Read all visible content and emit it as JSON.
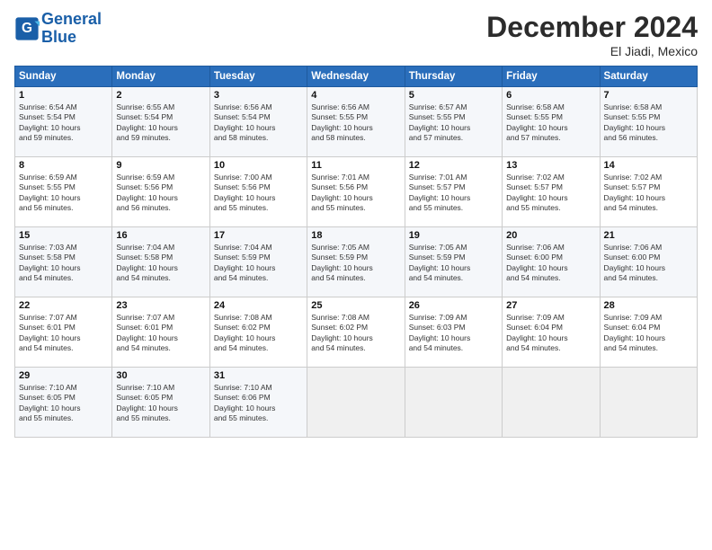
{
  "logo": {
    "line1": "General",
    "line2": "Blue"
  },
  "title": "December 2024",
  "location": "El Jiadi, Mexico",
  "days_of_week": [
    "Sunday",
    "Monday",
    "Tuesday",
    "Wednesday",
    "Thursday",
    "Friday",
    "Saturday"
  ],
  "weeks": [
    [
      {
        "day": "1",
        "info": "Sunrise: 6:54 AM\nSunset: 5:54 PM\nDaylight: 10 hours\nand 59 minutes."
      },
      {
        "day": "2",
        "info": "Sunrise: 6:55 AM\nSunset: 5:54 PM\nDaylight: 10 hours\nand 59 minutes."
      },
      {
        "day": "3",
        "info": "Sunrise: 6:56 AM\nSunset: 5:54 PM\nDaylight: 10 hours\nand 58 minutes."
      },
      {
        "day": "4",
        "info": "Sunrise: 6:56 AM\nSunset: 5:55 PM\nDaylight: 10 hours\nand 58 minutes."
      },
      {
        "day": "5",
        "info": "Sunrise: 6:57 AM\nSunset: 5:55 PM\nDaylight: 10 hours\nand 57 minutes."
      },
      {
        "day": "6",
        "info": "Sunrise: 6:58 AM\nSunset: 5:55 PM\nDaylight: 10 hours\nand 57 minutes."
      },
      {
        "day": "7",
        "info": "Sunrise: 6:58 AM\nSunset: 5:55 PM\nDaylight: 10 hours\nand 56 minutes."
      }
    ],
    [
      {
        "day": "8",
        "info": "Sunrise: 6:59 AM\nSunset: 5:55 PM\nDaylight: 10 hours\nand 56 minutes."
      },
      {
        "day": "9",
        "info": "Sunrise: 6:59 AM\nSunset: 5:56 PM\nDaylight: 10 hours\nand 56 minutes."
      },
      {
        "day": "10",
        "info": "Sunrise: 7:00 AM\nSunset: 5:56 PM\nDaylight: 10 hours\nand 55 minutes."
      },
      {
        "day": "11",
        "info": "Sunrise: 7:01 AM\nSunset: 5:56 PM\nDaylight: 10 hours\nand 55 minutes."
      },
      {
        "day": "12",
        "info": "Sunrise: 7:01 AM\nSunset: 5:57 PM\nDaylight: 10 hours\nand 55 minutes."
      },
      {
        "day": "13",
        "info": "Sunrise: 7:02 AM\nSunset: 5:57 PM\nDaylight: 10 hours\nand 55 minutes."
      },
      {
        "day": "14",
        "info": "Sunrise: 7:02 AM\nSunset: 5:57 PM\nDaylight: 10 hours\nand 54 minutes."
      }
    ],
    [
      {
        "day": "15",
        "info": "Sunrise: 7:03 AM\nSunset: 5:58 PM\nDaylight: 10 hours\nand 54 minutes."
      },
      {
        "day": "16",
        "info": "Sunrise: 7:04 AM\nSunset: 5:58 PM\nDaylight: 10 hours\nand 54 minutes."
      },
      {
        "day": "17",
        "info": "Sunrise: 7:04 AM\nSunset: 5:59 PM\nDaylight: 10 hours\nand 54 minutes."
      },
      {
        "day": "18",
        "info": "Sunrise: 7:05 AM\nSunset: 5:59 PM\nDaylight: 10 hours\nand 54 minutes."
      },
      {
        "day": "19",
        "info": "Sunrise: 7:05 AM\nSunset: 5:59 PM\nDaylight: 10 hours\nand 54 minutes."
      },
      {
        "day": "20",
        "info": "Sunrise: 7:06 AM\nSunset: 6:00 PM\nDaylight: 10 hours\nand 54 minutes."
      },
      {
        "day": "21",
        "info": "Sunrise: 7:06 AM\nSunset: 6:00 PM\nDaylight: 10 hours\nand 54 minutes."
      }
    ],
    [
      {
        "day": "22",
        "info": "Sunrise: 7:07 AM\nSunset: 6:01 PM\nDaylight: 10 hours\nand 54 minutes."
      },
      {
        "day": "23",
        "info": "Sunrise: 7:07 AM\nSunset: 6:01 PM\nDaylight: 10 hours\nand 54 minutes."
      },
      {
        "day": "24",
        "info": "Sunrise: 7:08 AM\nSunset: 6:02 PM\nDaylight: 10 hours\nand 54 minutes."
      },
      {
        "day": "25",
        "info": "Sunrise: 7:08 AM\nSunset: 6:02 PM\nDaylight: 10 hours\nand 54 minutes."
      },
      {
        "day": "26",
        "info": "Sunrise: 7:09 AM\nSunset: 6:03 PM\nDaylight: 10 hours\nand 54 minutes."
      },
      {
        "day": "27",
        "info": "Sunrise: 7:09 AM\nSunset: 6:04 PM\nDaylight: 10 hours\nand 54 minutes."
      },
      {
        "day": "28",
        "info": "Sunrise: 7:09 AM\nSunset: 6:04 PM\nDaylight: 10 hours\nand 54 minutes."
      }
    ],
    [
      {
        "day": "29",
        "info": "Sunrise: 7:10 AM\nSunset: 6:05 PM\nDaylight: 10 hours\nand 55 minutes."
      },
      {
        "day": "30",
        "info": "Sunrise: 7:10 AM\nSunset: 6:05 PM\nDaylight: 10 hours\nand 55 minutes."
      },
      {
        "day": "31",
        "info": "Sunrise: 7:10 AM\nSunset: 6:06 PM\nDaylight: 10 hours\nand 55 minutes."
      },
      null,
      null,
      null,
      null
    ]
  ]
}
